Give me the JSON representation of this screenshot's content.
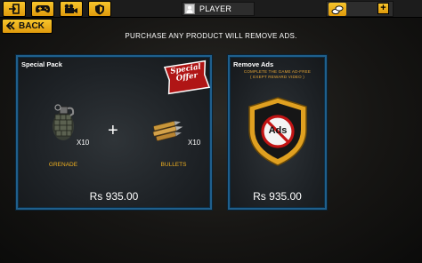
{
  "top_bar": {
    "player_name": "PLAYER",
    "plus_label": "+",
    "icons": [
      "exit-icon",
      "gamepad-icon",
      "video-camera-icon",
      "shield-icon",
      "coins-icon"
    ]
  },
  "back_label": "BACK",
  "notice": "PURCHASE ANY PRODUCT WILL REMOVE ADS.",
  "special_pack": {
    "title": "Special Pack",
    "badge_line1": "Special",
    "badge_line2": "Offer",
    "plus_sign": "+",
    "items": [
      {
        "name": "GRENADE",
        "qty": "X10",
        "icon": "grenade-icon"
      },
      {
        "name": "BULLETS",
        "qty": "X10",
        "icon": "bullets-icon"
      }
    ],
    "price": "Rs 935.00"
  },
  "remove_ads": {
    "title": "Remove Ads",
    "desc_line1": "Complete the game Ad-free",
    "desc_line2": "( Exept reward video )",
    "shield_text": "Ads",
    "price": "Rs 935.00"
  },
  "colors": {
    "accent_yellow": "#f2b41c",
    "panel_border": "#1f5f8c",
    "label_orange": "#f0b020",
    "badge_red": "#b01515"
  }
}
